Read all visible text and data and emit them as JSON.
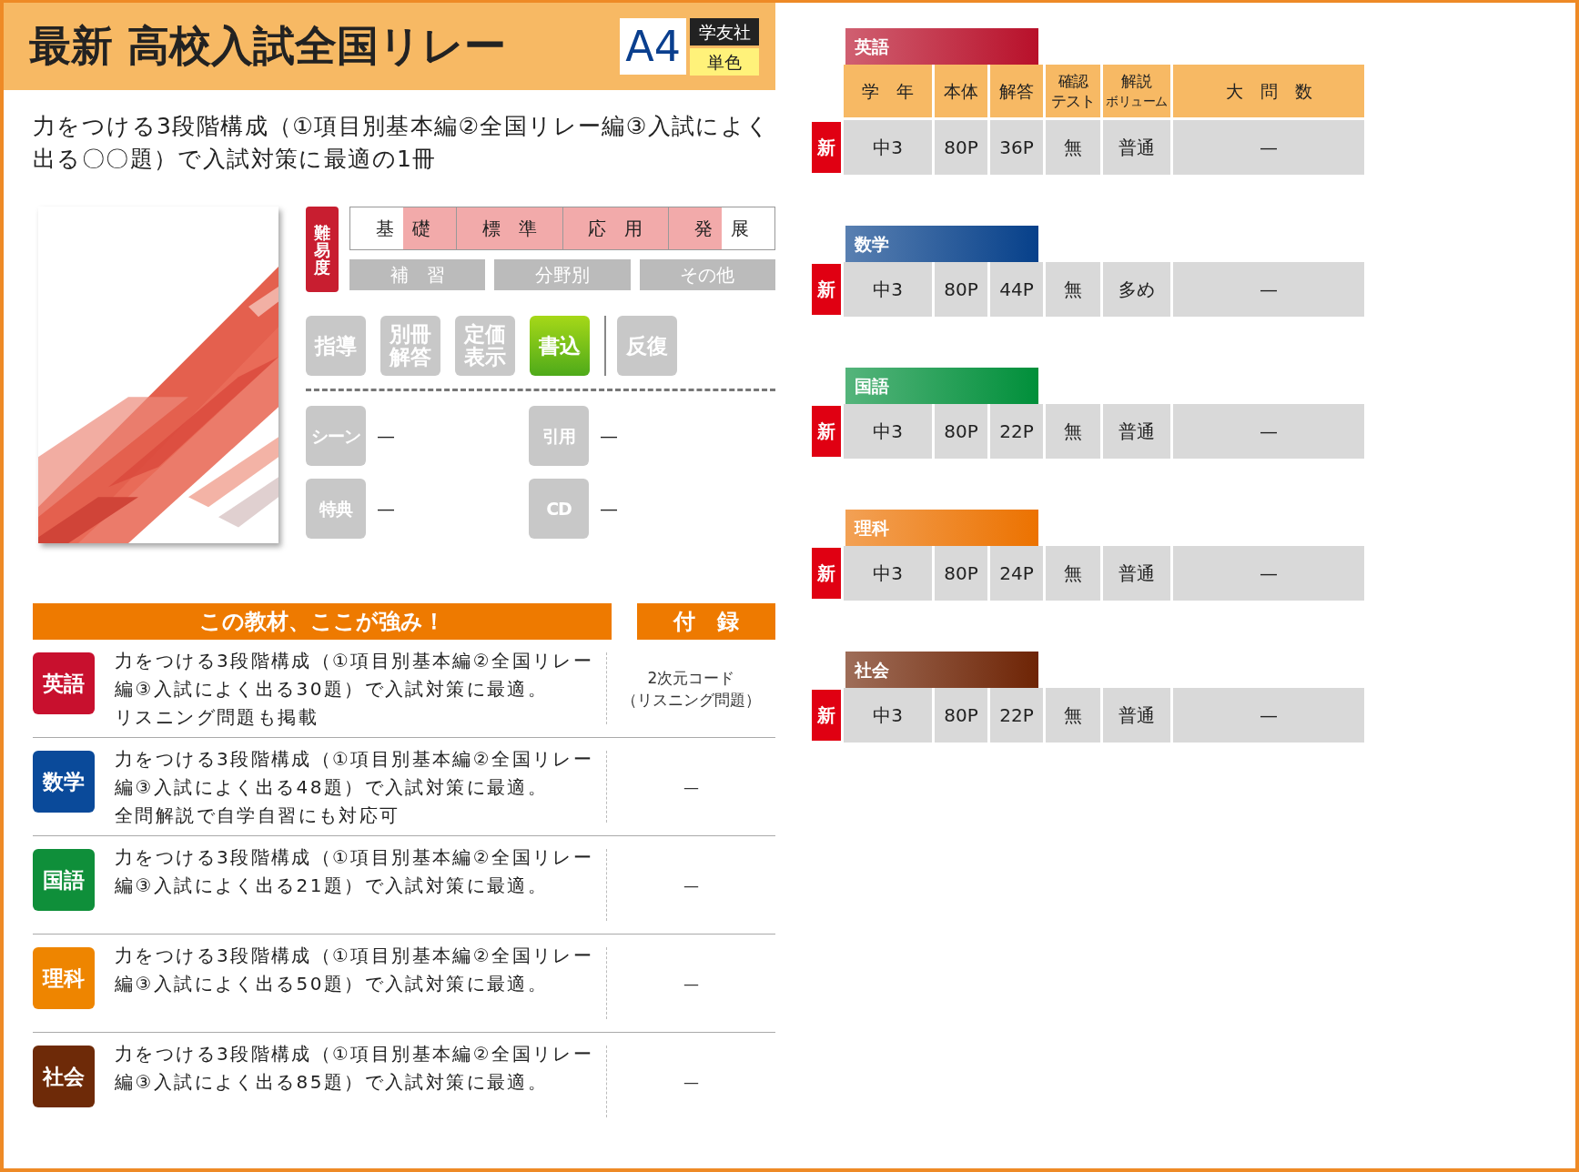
{
  "header": {
    "title": "最新 高校入試全国リレー",
    "size": "A4",
    "publisher": "学友社",
    "print": "単色"
  },
  "description": "力をつける3段階構成（①項目別基本編②全国リレー編③入試によく出る〇〇題）で入試対策に最適の1冊",
  "difficulty": {
    "label": "難易度",
    "levels": [
      {
        "label": "基　礎",
        "shaded_left": false,
        "shaded_right": true
      },
      {
        "label": "標　準",
        "shaded_left": true,
        "shaded_right": true
      },
      {
        "label": "応　用",
        "shaded_left": true,
        "shaded_right": true
      },
      {
        "label": "発　展",
        "shaded_left": true,
        "shaded_right": false
      }
    ],
    "types": [
      {
        "label": "補　習",
        "selected": false
      },
      {
        "label": "分野別",
        "selected": false
      },
      {
        "label": "その他",
        "selected": false
      }
    ]
  },
  "features": [
    {
      "label": "指導",
      "on": false,
      "separated": false
    },
    {
      "label": "別冊解答",
      "on": false,
      "separated": false
    },
    {
      "label": "定価表示",
      "on": false,
      "separated": false
    },
    {
      "label": "書込",
      "on": true,
      "separated": false
    },
    {
      "label": "反復",
      "on": false,
      "separated": true
    }
  ],
  "extras": [
    {
      "label": "シーン",
      "value": "—",
      "on": false
    },
    {
      "label": "引用",
      "value": "—",
      "on": false
    },
    {
      "label": "特典",
      "value": "—",
      "on": false
    },
    {
      "label": "CD",
      "value": "—",
      "on": false
    }
  ],
  "strengths": {
    "heading": "この教材、ここが強み！",
    "appendix_heading": "付　録",
    "rows": [
      {
        "subject": "英語",
        "color": "#c8102e",
        "text": "力をつける3段階構成（①項目別基本編②全国リレー編③入試によく出る30題）で入試対策に最適。",
        "note": "リスニング問題も掲載",
        "appendix": [
          "2次元コード",
          "（リスニング問題）"
        ]
      },
      {
        "subject": "数学",
        "color": "#0a4a9a",
        "text": "力をつける3段階構成（①項目別基本編②全国リレー編③入試によく出る48題）で入試対策に最適。",
        "note": "全問解説で自学自習にも対応可",
        "appendix": [
          "—"
        ]
      },
      {
        "subject": "国語",
        "color": "#0f8f3a",
        "text": "力をつける3段階構成（①項目別基本編②全国リレー編③入試によく出る21題）で入試対策に最適。",
        "appendix": [
          "—"
        ]
      },
      {
        "subject": "理科",
        "color": "#ee8500",
        "text": "力をつける3段階構成（①項目別基本編②全国リレー編③入試によく出る50題）で入試対策に最適。",
        "appendix": [
          "—"
        ]
      },
      {
        "subject": "社会",
        "color": "#6e2a08",
        "text": "力をつける3段階構成（①項目別基本編②全国リレー編③入試によく出る85題）で入試対策に最適。",
        "appendix": [
          "—"
        ]
      }
    ]
  },
  "specs": {
    "columns": [
      [
        "学　年"
      ],
      [
        "本体"
      ],
      [
        "解答"
      ],
      [
        "確認",
        "テスト"
      ],
      [
        "解説",
        "ボリューム"
      ],
      [
        "大　問　数"
      ]
    ],
    "sections": [
      {
        "subject": "英語",
        "color": "#b8102a",
        "header": true,
        "new": true,
        "new_label": "新",
        "cells": [
          "中3",
          "80P",
          "36P",
          "無",
          "普通",
          "—"
        ]
      },
      {
        "subject": "数学",
        "color": "#06408a",
        "header": false,
        "new": true,
        "new_label": "新",
        "cells": [
          "中3",
          "80P",
          "44P",
          "無",
          "多め",
          "—"
        ]
      },
      {
        "subject": "国語",
        "color": "#008f3a",
        "header": false,
        "new": true,
        "new_label": "新",
        "cells": [
          "中3",
          "80P",
          "22P",
          "無",
          "普通",
          "—"
        ]
      },
      {
        "subject": "理科",
        "color": "#ec7200",
        "header": false,
        "new": true,
        "new_label": "新",
        "cells": [
          "中3",
          "80P",
          "24P",
          "無",
          "普通",
          "—"
        ]
      },
      {
        "subject": "社会",
        "color": "#6e2405",
        "header": false,
        "new": true,
        "new_label": "新",
        "cells": [
          "中3",
          "80P",
          "22P",
          "無",
          "普通",
          "—"
        ]
      }
    ]
  }
}
